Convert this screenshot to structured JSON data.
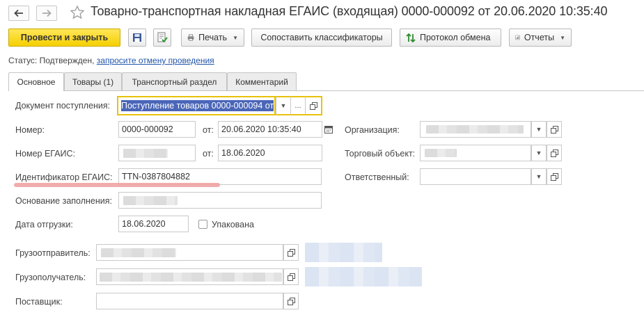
{
  "window": {
    "title": "Товарно-транспортная накладная ЕГАИС (входящая) 0000-000092 от 20.06.2020 10:35:40"
  },
  "toolbar": {
    "post_close_label": "Провести и закрыть",
    "print_label": "Печать",
    "compare_label": "Сопоставить классификаторы",
    "protocol_label": "Протокол обмена",
    "reports_label": "Отчеты"
  },
  "status": {
    "prefix": "Статус:",
    "value": "Подтвержден,",
    "link": "запросите отмену проведения"
  },
  "tabs": [
    {
      "label": "Основное",
      "active": true
    },
    {
      "label": "Товары (1)",
      "active": false
    },
    {
      "label": "Транспортный раздел",
      "active": false
    },
    {
      "label": "Комментарий",
      "active": false
    }
  ],
  "form": {
    "receipt_doc_label": "Документ поступления:",
    "receipt_doc_value": "Поступление товаров 0000-000094 от",
    "number_label": "Номер:",
    "number_value": "0000-000092",
    "from_label": "от:",
    "date_value": "20.06.2020 10:35:40",
    "org_label": "Организация:",
    "egais_number_label": "Номер ЕГАИС:",
    "egais_date_value": "18.06.2020",
    "trade_object_label": "Торговый объект:",
    "egais_id_label": "Идентификатор ЕГАИС:",
    "egais_id_value": "TTN-0387804882",
    "responsible_label": "Ответственный:",
    "fill_basis_label": "Основание заполнения:",
    "ship_date_label": "Дата отгрузки:",
    "ship_date_value": "18.06.2020",
    "packed_label": "Упакована",
    "shipper_label": "Грузоотправитель:",
    "consignee_label": "Грузополучатель:",
    "supplier_label": "Поставщик:"
  },
  "colors": {
    "primary_button": "#f5d000",
    "focus_border": "#e9c20a",
    "selection": "#4a66b8",
    "link": "#2255aa",
    "annotation_underline": "#f0a3a3"
  }
}
